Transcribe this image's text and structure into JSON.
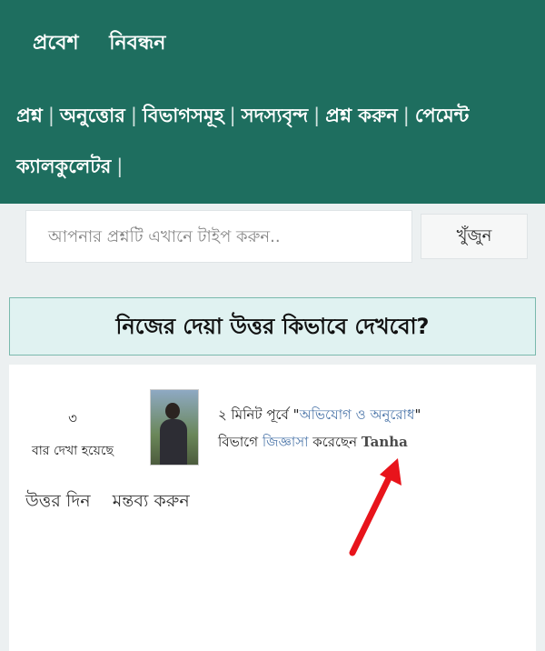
{
  "header": {
    "login": "প্রবেশ",
    "register": "নিবন্ধন",
    "nav_row1": [
      "প্রশ্ন",
      "অনুত্তোর",
      "বিভাগসমূহ",
      "সদস্যবৃন্দ",
      "প্রশ্ন করুন",
      "পেমেন্ট"
    ],
    "nav_row2": [
      "ক্যালকুলেটর"
    ]
  },
  "search": {
    "placeholder": "আপনার প্রশ্নটি এখানে টাইপ করুন..",
    "button": "খুঁজুন"
  },
  "question": {
    "title": "নিজের দেয়া উত্তর কিভাবে দেখবো?",
    "views_count": "৩",
    "views_label": "বার দেখা হয়েছে",
    "time": "২ মিনিট পূর্বে",
    "quote_open": "\"",
    "category": "অভিযোগ ও অনুরোধ",
    "quote_close": "\"",
    "category_suffix": "বিভাগে",
    "asked_link": "জিজ্ঞাসা",
    "asked_suffix": "করেছেন",
    "user": "Tanha",
    "answer_label": "উত্তর দিন",
    "comment_label": "মন্তব্য করুন"
  },
  "colors": {
    "header_bg": "#1e6e5f",
    "title_bg": "#e0f2f1",
    "link": "#4a74a8",
    "arrow": "#e8141b"
  }
}
